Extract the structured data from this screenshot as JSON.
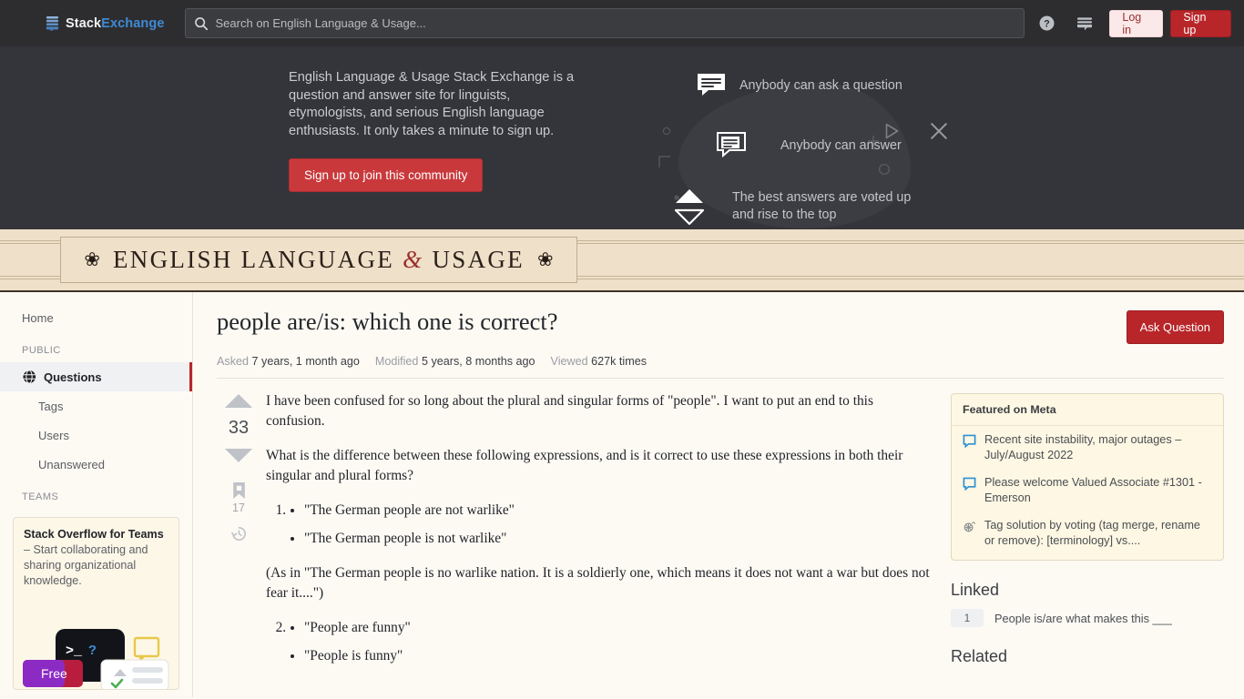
{
  "topnav": {
    "logo_primary": "Stack",
    "logo_secondary": "Exchange",
    "logo_icon": "stack-exchange-logo-icon",
    "search_placeholder": "Search on English Language & Usage...",
    "search_value": "",
    "search_icon": "search-icon",
    "help_icon": "help-circle-icon",
    "inbox_icon": "inbox-icon",
    "login_label": "Log in",
    "signup_label": "Sign up"
  },
  "hero": {
    "description": "English Language & Usage Stack Exchange is a question and answer site for linguists, etymologists, and serious English language enthusiasts. It only takes a minute to sign up.",
    "cta_label": "Sign up to join this community",
    "points": [
      {
        "icon": "speech-bubble-filled-icon",
        "text": "Anybody can ask a question"
      },
      {
        "icon": "speech-bubble-outline-icon",
        "text": "Anybody can answer"
      },
      {
        "icon": "vote-arrows-icon",
        "text": "The best answers are voted up and rise to the top"
      }
    ],
    "play_icon": "play-triangle-icon",
    "close_icon": "close-icon"
  },
  "site_banner": {
    "title_part1": "ENGLISH LANGUAGE",
    "title_amp": "&",
    "title_part2": "USAGE",
    "ornament_icon": "fleuron-ornament-icon"
  },
  "sidebar": {
    "home_label": "Home",
    "public_header": "PUBLIC",
    "items": [
      {
        "label": "Questions",
        "icon": "globe-icon",
        "active": true
      },
      {
        "label": "Tags",
        "active": false
      },
      {
        "label": "Users",
        "active": false
      },
      {
        "label": "Unanswered",
        "active": false
      }
    ],
    "teams_header": "TEAMS",
    "teams_card": {
      "title": "Stack Overflow for Teams",
      "body": " – Start collaborating and sharing organizational knowledge.",
      "badge": "Free",
      "terminal_text": ">_?"
    }
  },
  "question": {
    "title": "people are/is: which one is correct?",
    "ask_button": "Ask Question",
    "meta": [
      {
        "label": "Asked",
        "value": "7 years, 1 month ago"
      },
      {
        "label": "Modified",
        "value": "5 years, 8 months ago"
      },
      {
        "label": "Viewed",
        "value": "627k times"
      }
    ],
    "votes": {
      "score": "33",
      "bookmarks": "17",
      "up_icon": "upvote-arrow-icon",
      "down_icon": "downvote-arrow-icon",
      "bookmark_icon": "bookmark-icon",
      "history_icon": "edit-history-clock-icon"
    },
    "body": {
      "p1": "I have been confused for so long about the plural and singular forms of \"people\". I want to put an end to this confusion.",
      "p2": "What is the difference between these following expressions, and is it correct to use these expressions in both their singular and plural forms?",
      "list1": [
        "\"The German people are not warlike\"",
        "\"The German people is not warlike\""
      ],
      "p3": "(As in \"The German people is no warlike nation. It is a soldierly one, which means it does not want a war but does not fear it....\")",
      "list2": [
        "\"People are funny\"",
        "\"People is funny\""
      ]
    }
  },
  "rail": {
    "featured": {
      "header": "Featured on Meta",
      "items": [
        {
          "icon": "speech-bubble-blue-icon",
          "text": "Recent site instability, major outages – July/August 2022"
        },
        {
          "icon": "speech-bubble-blue-icon",
          "text": "Please welcome Valued Associate #1301 - Emerson"
        },
        {
          "icon": "tumbleweed-icon",
          "text": "Tag solution by voting (tag merge, rename or remove): [terminology] vs...."
        }
      ]
    },
    "linked_header": "Linked",
    "linked": [
      {
        "score": "1",
        "title": "People is/are what makes this ___"
      }
    ],
    "related_header": "Related"
  },
  "colors": {
    "brand_red": "#b8262a",
    "hero_bg": "#34353a",
    "banner_bg": "#eee0c9",
    "page_bg": "#fdfaf4",
    "meta_card_bg": "#fdf7e3"
  }
}
